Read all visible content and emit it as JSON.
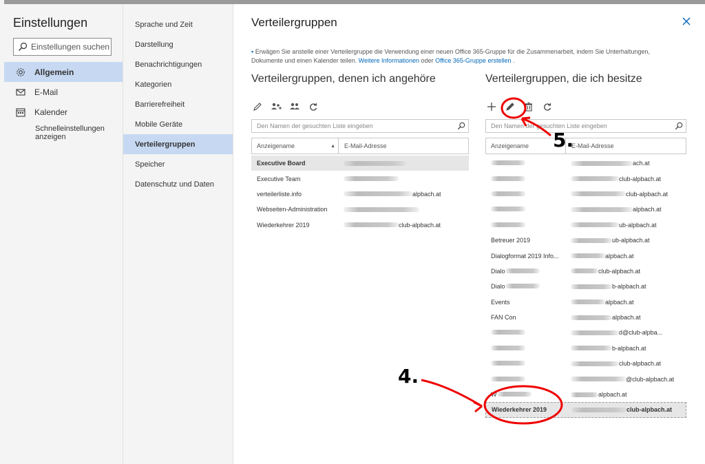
{
  "settings": {
    "title": "Einstellungen",
    "search_placeholder": "Einstellungen suchen",
    "nav": [
      {
        "label": "Allgemein",
        "icon": "gear-icon",
        "active": true
      },
      {
        "label": "E-Mail",
        "icon": "mail-icon",
        "active": false
      },
      {
        "label": "Kalender",
        "icon": "calendar-icon",
        "active": false
      }
    ],
    "quick_settings": "Schnelleinstellungen anzeigen"
  },
  "subnav": [
    "Sprache und Zeit",
    "Darstellung",
    "Benachrichtigungen",
    "Kategorien",
    "Barrierefreiheit",
    "Mobile Geräte",
    "Verteilergruppen",
    "Speicher",
    "Datenschutz und Daten"
  ],
  "subnav_active": "Verteilergruppen",
  "main": {
    "title": "Verteilergruppen",
    "info_text": "Erwägen Sie anstelle einer Verteilergruppe die Verwendung einer neuen Office 365-Gruppe für die Zusammenarbeit, indem Sie Unterhaltungen, Dokumente und einen Kalender teilen.",
    "info_link1": "Weitere Informationen",
    "info_or": "oder",
    "info_link2": "Office 365-Gruppe erstellen",
    "info_end": "."
  },
  "member_of": {
    "title": "Verteilergruppen, denen ich angehöre",
    "search_placeholder": "Den Namen der gesuchten Liste eingeben",
    "col_name": "Anzeigename",
    "col_email": "E-Mail-Adresse",
    "rows": [
      {
        "name": "Executive Board",
        "email": ""
      },
      {
        "name": "Executive Team",
        "email": ""
      },
      {
        "name": "verteilerliste.info",
        "email": "alpbach.at"
      },
      {
        "name": "Webseiten-Administration",
        "email": ""
      },
      {
        "name": "Wiederkehrer 2019",
        "email": "club-alpbach.at"
      }
    ]
  },
  "owner_of": {
    "title": "Verteilergruppen, die ich besitze",
    "search_placeholder": "Den Namen der gesuchten Liste eingeben",
    "col_name": "Anzeigename",
    "col_email": "E-Mail-Adresse",
    "rows": [
      {
        "name": "",
        "email": "ach.at"
      },
      {
        "name": "",
        "email": "club-alpbach.at"
      },
      {
        "name": "",
        "email": "club-alpbach.at"
      },
      {
        "name": "",
        "email": "alpbach.at"
      },
      {
        "name": "",
        "email": "ub-alpbach.at"
      },
      {
        "name": "Betreuer 2019",
        "email": "ub-alpbach.at"
      },
      {
        "name": "Dialogformat 2019 Info...",
        "email": "alpbach.at"
      },
      {
        "name": "Dialo",
        "email": "club-alpbach.at"
      },
      {
        "name": "Dialo",
        "email": "b-alpbach.at"
      },
      {
        "name": "Events",
        "email": "alpbach.at"
      },
      {
        "name": "FAN Con",
        "email": "alpbach.at"
      },
      {
        "name": "",
        "email": "d@club-alpba..."
      },
      {
        "name": "",
        "email": "b-alpbach.at"
      },
      {
        "name": "",
        "email": "club-alpbach.at"
      },
      {
        "name": "",
        "email": "@club-alpbach.at"
      },
      {
        "name": "W",
        "email": "alpbach.at"
      },
      {
        "name": "Wiederkehrer 2019",
        "email": "club-alpbach.at"
      }
    ]
  },
  "annotations": {
    "step4": "4.",
    "step5": "5."
  }
}
